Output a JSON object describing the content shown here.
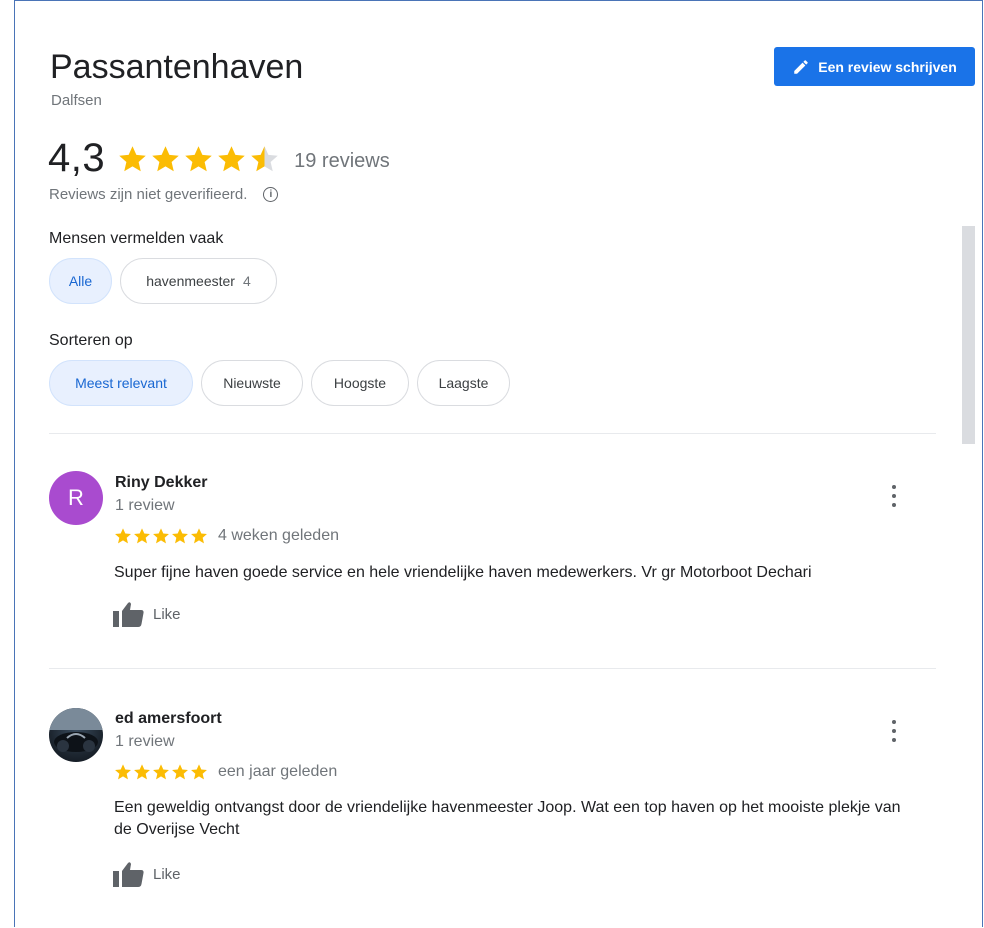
{
  "place": {
    "title": "Passantenhaven",
    "subtitle": "Dalfsen",
    "write_review_label": "Een review schrijven",
    "rating_value": "4,3",
    "rating_numeric": 4.3,
    "reviews_count": "19 reviews",
    "unverified_note": "Reviews zijn niet geverifieerd.",
    "info_icon": "i",
    "star_color": "#fbbc04",
    "accent_color": "#1a73e8"
  },
  "mentions": {
    "label": "Mensen vermelden vaak",
    "chips": [
      {
        "label": "Alle",
        "count": "",
        "active": true
      },
      {
        "label": "havenmeester",
        "count": "4",
        "active": false
      }
    ]
  },
  "sort": {
    "label": "Sorteren op",
    "chips": [
      {
        "label": "Meest relevant",
        "active": true
      },
      {
        "label": "Nieuwste",
        "active": false
      },
      {
        "label": "Hoogste",
        "active": false
      },
      {
        "label": "Laagste",
        "active": false
      }
    ]
  },
  "reviews": [
    {
      "avatar_letter": "R",
      "avatar_color": "#a94bcf",
      "name": "Riny Dekker",
      "review_count": "1 review",
      "stars": 5,
      "time": "4 weken geleden",
      "text": "Super fijne haven goede service en hele vriendelijke haven medewerkers. Vr gr Motorboot Dechari",
      "like_label": "Like"
    },
    {
      "avatar_letter": "",
      "avatar_color": "#1d2630",
      "name": "ed amersfoort",
      "review_count": "1 review",
      "stars": 5,
      "time": "een jaar geleden",
      "text": "Een geweldig ontvangst door de vriendelijke havenmeester Joop. Wat een top haven op het mooiste plekje van de Overijse Vecht",
      "like_label": "Like"
    }
  ]
}
